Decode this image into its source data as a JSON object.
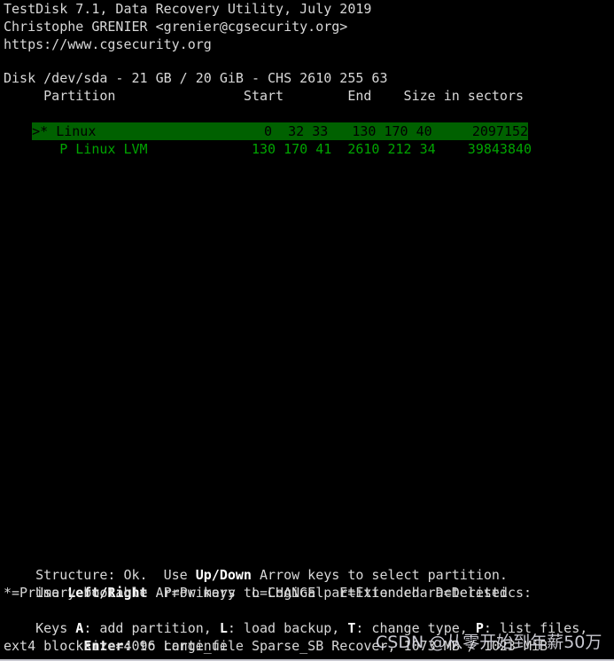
{
  "app": {
    "title_line": "TestDisk 7.1, Data Recovery Utility, July 2019",
    "author_line": "Christophe GRENIER <grenier@cgsecurity.org>",
    "website_line": "https://www.cgsecurity.org"
  },
  "disk": {
    "info_line": "Disk /dev/sda - 21 GB / 20 GiB - CHS 2610 255 63"
  },
  "table": {
    "headers": {
      "partition": "Partition",
      "start": "Start",
      "end": "End",
      "size": "Size in sectors"
    },
    "header_line": "     Partition                Start        End    Size in sectors",
    "rows": [
      {
        "selected": true,
        "marker": ">",
        "flag": "*",
        "name": "Linux",
        "start": "0  32 33",
        "end": "130 170 40",
        "size": "2097152",
        "line": ">* Linux                     0  32 33   130 170 40     2097152"
      },
      {
        "selected": false,
        "marker": " ",
        "flag": "P",
        "name": "Linux LVM",
        "start": "130 170 41",
        "end": "2610 212 34",
        "size": "39843840",
        "line": "   P Linux LVM             130 170 41  2610 212 34    39843840"
      }
    ]
  },
  "help": {
    "structure_prefix": "Structure: Ok.  Use ",
    "structure_key": "Up/Down",
    "structure_suffix": " Arrow keys to select partition.",
    "change_prefix": "Use ",
    "change_key": "Left/Right",
    "change_suffix": " Arrow keys to CHANGE partition characteristics:",
    "legend_line": "*=Primary bootable  P=Primary  L=Logical  E=Extended  D=Deleted",
    "keys_prefix": "Keys ",
    "key_a": "A",
    "keys_a_text": ": add partition, ",
    "key_l": "L",
    "keys_l_text": ": load backup, ",
    "key_t": "T",
    "keys_t_text": ": change type, ",
    "key_p": "P",
    "keys_p_text": ": list files,",
    "enter_indent": "      ",
    "key_enter": "Enter",
    "enter_text": ": to continue"
  },
  "status": {
    "fs_line": "ext4 blocksize=4096 Large_file Sparse_SB Recover, 1073 MB / 1023 MiB"
  },
  "watermark": {
    "text": "CSDN @从零开始到年薪50万"
  },
  "colors": {
    "background": "#000000",
    "foreground": "#d8d8d8",
    "partition_green": "#00a400",
    "selected_background": "#006100",
    "selected_foreground": "#000000"
  }
}
